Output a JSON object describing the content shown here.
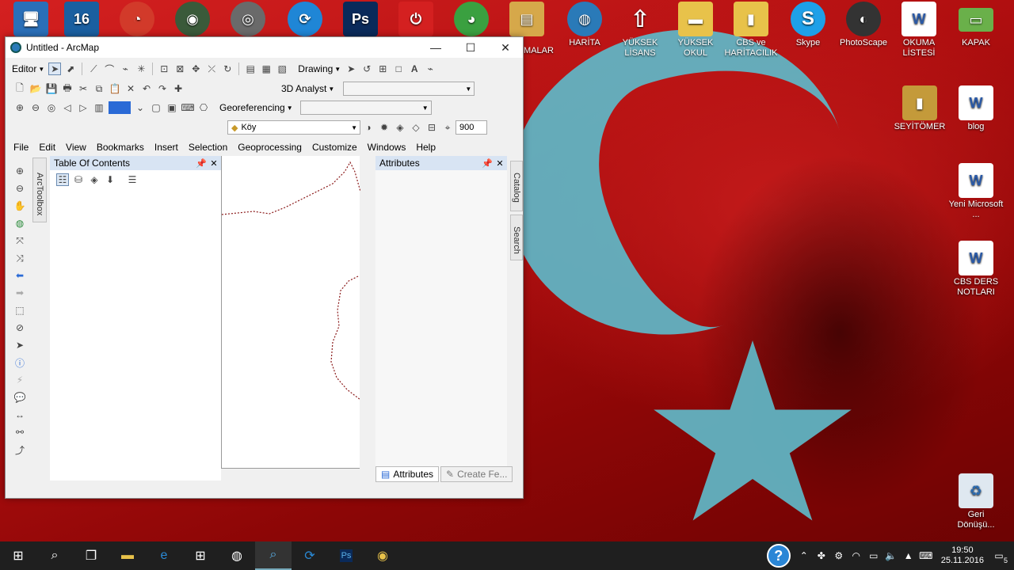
{
  "desktop": {
    "top_icons": [
      {
        "label": "",
        "glyph": "🖥",
        "color": "#2a6fb8"
      },
      {
        "label": "",
        "glyph": "16",
        "color": "#1a5fa0"
      },
      {
        "label": "",
        "glyph": "◔",
        "color": "#d23a2a"
      },
      {
        "label": "",
        "glyph": "◉",
        "color": "#3a5a3a"
      },
      {
        "label": "",
        "glyph": "◎",
        "color": "#6a6a6a"
      },
      {
        "label": "",
        "glyph": "⟳",
        "color": "#1f86d6"
      },
      {
        "label": "",
        "glyph": "Ps",
        "color": "#0a2a5a"
      },
      {
        "label": "",
        "glyph": "⏻",
        "color": "#d42020"
      },
      {
        "label": "",
        "glyph": "◕",
        "color": "#3aa040"
      },
      {
        "label": "",
        "glyph": "▤",
        "color": "#d6a84a"
      },
      {
        "label": "MALAR",
        "glyph": "",
        "color": "transparent"
      },
      {
        "label": "HARİTA",
        "glyph": "◍",
        "color": "#2a7ab8"
      },
      {
        "label": "YÜKSEK LİSANS",
        "glyph": "⇧",
        "color": "transparent"
      },
      {
        "label": "YÜKSEK OKUL",
        "glyph": "▬",
        "color": "#e8c24a"
      },
      {
        "label": "CBS ve HARİTACILIK",
        "glyph": "▮",
        "color": "#e8c24a"
      },
      {
        "label": "Skype",
        "glyph": "S",
        "color": "#1ea0e8"
      },
      {
        "label": "PhotoScape",
        "glyph": "◐",
        "color": "#333333"
      },
      {
        "label": "OKUMA LİSTESİ",
        "glyph": "W",
        "color": "#2a5aa8"
      },
      {
        "label": "KAPAK",
        "glyph": "▭",
        "color": "#6ab04a"
      }
    ],
    "side_icons": [
      {
        "label": "SEYİTÖMER",
        "glyph": "▮",
        "color": "#c49a3a"
      },
      {
        "label": "blog",
        "glyph": "W",
        "color": "#2a5aa8"
      },
      {
        "label": "Yeni Microsoft ...",
        "glyph": "W",
        "color": "#2a5aa8"
      },
      {
        "label": "CBS DERS NOTLARI",
        "glyph": "W",
        "color": "#2a5aa8"
      },
      {
        "label": "Geri Dönüşü...",
        "glyph": "♻",
        "color": "#6a8ab0"
      }
    ]
  },
  "window": {
    "title": "Untitled - ArcMap",
    "minimize": "—",
    "maximize": "☐",
    "close": "✕"
  },
  "toolbars": {
    "editor": "Editor",
    "drawing": "Drawing",
    "analyst": "3D Analyst",
    "georeferencing": "Georeferencing",
    "layer_combo": "Köy",
    "scale_value": "900"
  },
  "menu": [
    "File",
    "Edit",
    "View",
    "Bookmarks",
    "Insert",
    "Selection",
    "Geoprocessing",
    "Customize",
    "Windows",
    "Help"
  ],
  "panels": {
    "toc_title": "Table Of Contents",
    "toolbox_tab": "ArcToolbox",
    "attributes_title": "Attributes",
    "catalog_tab": "Catalog",
    "search_tab": "Search",
    "bottom_tabs": [
      "Attributes",
      "Create Fe..."
    ]
  },
  "taskbar": {
    "time": "19:50",
    "date": "25.11.2016",
    "notifications": "5",
    "help": "?"
  },
  "colors": {
    "flag_red": "#c31a1a",
    "crescent": "#5fb8c8",
    "taskbar": "#1f1f1f",
    "toc_header": "#d8e4f3",
    "boundary": "#8b1a1a"
  }
}
